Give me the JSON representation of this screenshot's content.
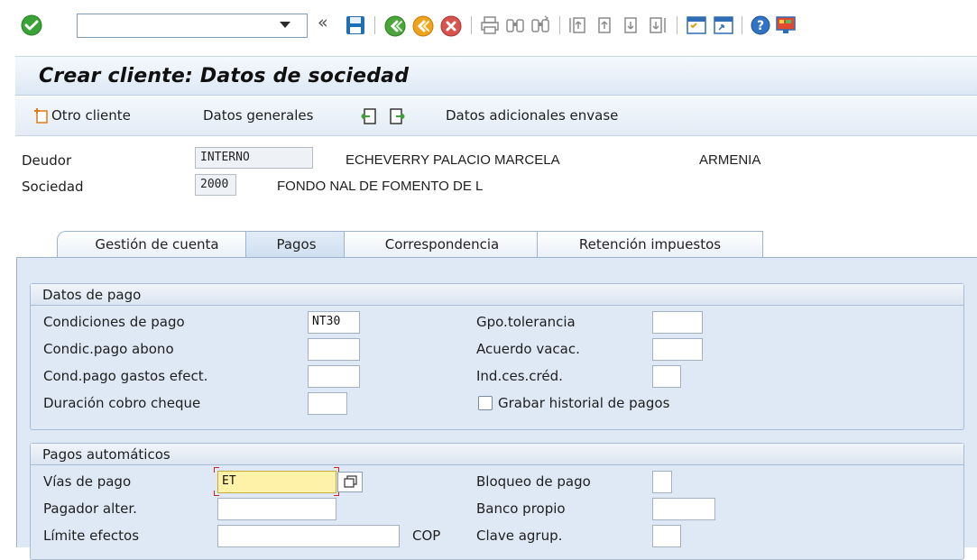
{
  "toolbar": {
    "command_field_value": "",
    "icons": [
      "enter-icon",
      "save-icon",
      "back-icon",
      "exit-icon",
      "cancel-icon",
      "print-icon",
      "find-icon",
      "find-next-icon",
      "first-page-icon",
      "previous-page-icon",
      "next-page-icon",
      "last-page-icon",
      "new-session-icon",
      "shortcut-icon",
      "help-icon",
      "customize-layout-icon"
    ]
  },
  "title": "Crear cliente: Datos de sociedad",
  "app_toolbar": {
    "other_customer": "Otro cliente",
    "general_data": "Datos generales",
    "additional_data": "Datos adicionales envase"
  },
  "header": {
    "debtor_label": "Deudor",
    "debtor_value": "INTERNO",
    "debtor_name": "ECHEVERRY PALACIO MARCELA",
    "debtor_city": "ARMENIA",
    "company_label": "Sociedad",
    "company_value": "2000",
    "company_name": "FONDO NAL DE FOMENTO DE L"
  },
  "tabs": [
    {
      "label": "Gestión de cuenta",
      "active": false
    },
    {
      "label": "Pagos",
      "active": true
    },
    {
      "label": "Correspondencia",
      "active": false
    },
    {
      "label": "Retención impuestos",
      "active": false
    }
  ],
  "payment_data": {
    "title": "Datos de pago",
    "fields": [
      {
        "label": "Condiciones de pago",
        "value": "NT30"
      },
      {
        "label": "Condic.pago abono",
        "value": ""
      },
      {
        "label": "Cond.pago gastos efect.",
        "value": ""
      },
      {
        "label": "Duración cobro cheque",
        "value": ""
      }
    ],
    "right_fields": [
      {
        "label": "Gpo.tolerancia",
        "value": ""
      },
      {
        "label": "Acuerdo vacac.",
        "value": ""
      },
      {
        "label": "Ind.ces.créd.",
        "value": ""
      }
    ],
    "checkbox_label": "Grabar historial de pagos",
    "checkbox_checked": false
  },
  "automatic_payments": {
    "title": "Pagos automáticos",
    "fields": [
      {
        "label": "Vías de pago",
        "value": "ET"
      },
      {
        "label": "Pagador alter.",
        "value": ""
      },
      {
        "label": "Límite efectos",
        "value": "",
        "unit": "COP"
      }
    ],
    "right_fields": [
      {
        "label": "Bloqueo de pago",
        "value": ""
      },
      {
        "label": "Banco propio",
        "value": ""
      },
      {
        "label": "Clave agrup.",
        "value": ""
      }
    ]
  },
  "colors": {
    "panel_bg": "#dfe9f5",
    "focus_field": "#fdf2a8",
    "enter_green": "#3aa335",
    "cancel_red": "#d9534f"
  }
}
